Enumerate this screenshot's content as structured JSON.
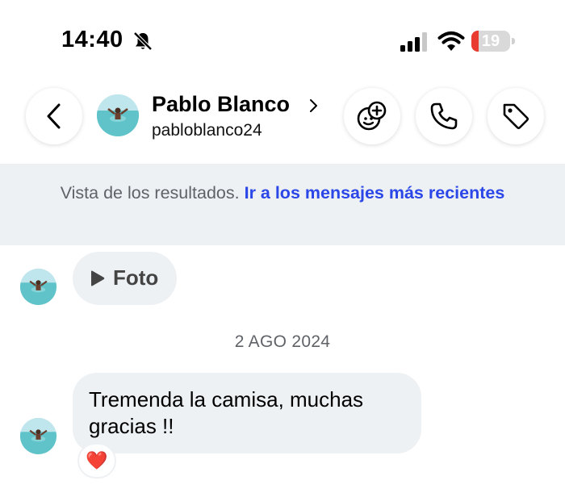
{
  "status_bar": {
    "time": "14:40",
    "battery_level": "19",
    "battery_color": "#ea3b30",
    "icons": [
      "bell-slash-icon",
      "signal-icon",
      "wifi-icon",
      "battery-icon"
    ]
  },
  "header": {
    "name": "Pablo Blanco",
    "username": "pabloblanco24",
    "icons": [
      "back-chevron-icon",
      "sticker-face-icon",
      "phone-icon",
      "tag-icon"
    ]
  },
  "banner": {
    "muted_text": "Vista de los resultados.",
    "link_text": "Ir a los mensajes más recientes",
    "link_color": "#2b47e8"
  },
  "messages": [
    {
      "type": "photo",
      "label": "Foto",
      "icon": "play-icon"
    },
    {
      "type": "date_separator",
      "text": "2 AGO 2024"
    },
    {
      "type": "text",
      "text": "Tremenda la camisa, muchas gracias !!",
      "reaction": "❤️"
    }
  ],
  "colors": {
    "bubble": "#eef1f4",
    "banner_bg": "#eef1f4"
  }
}
